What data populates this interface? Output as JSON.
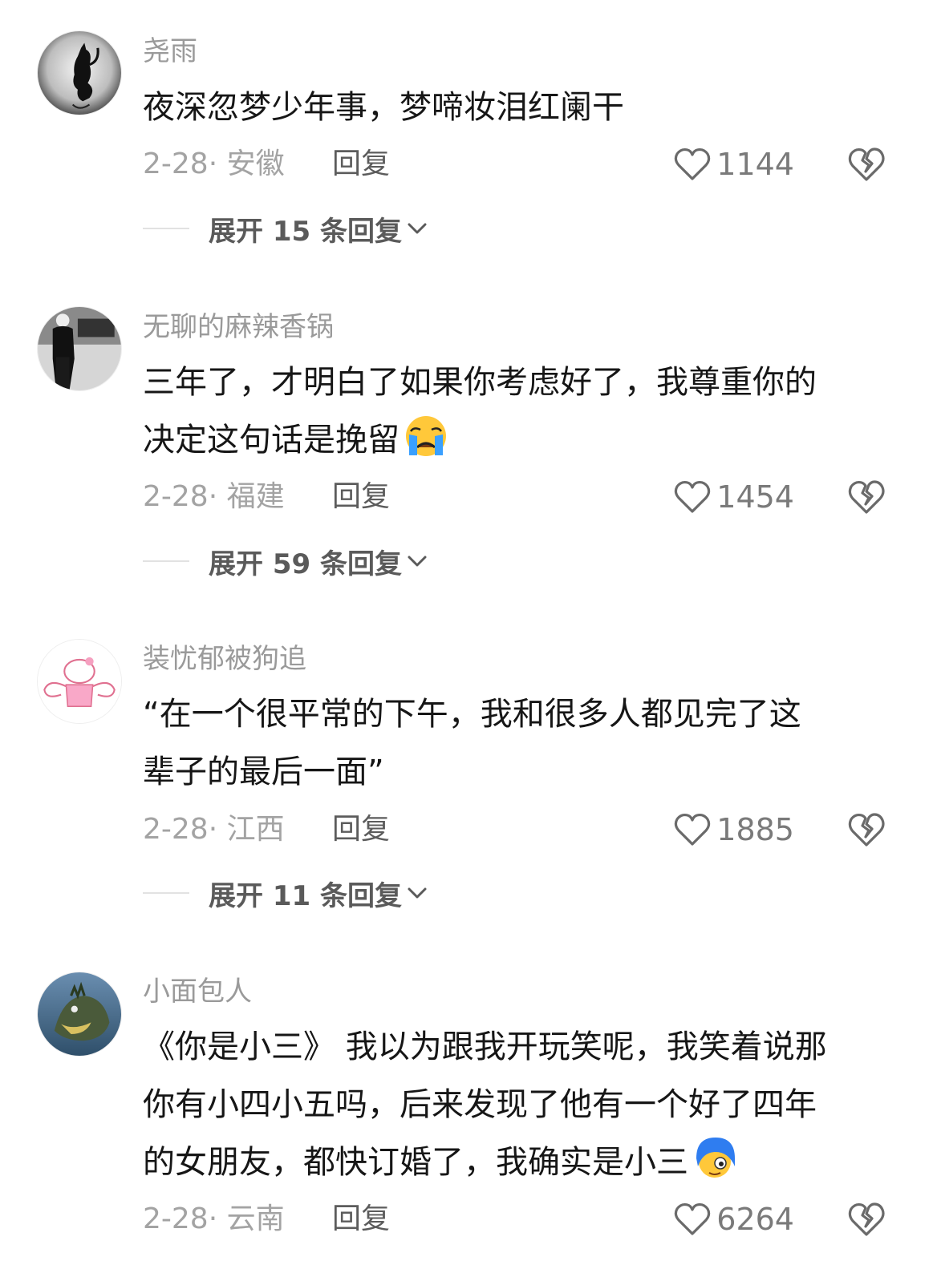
{
  "comments": [
    {
      "username": "尧雨",
      "lines": [
        "夜深忽梦少年事，梦啼妆泪红阑干"
      ],
      "emoji": null,
      "date_location": "2-28· 安徽",
      "reply_label": "回复",
      "likes": "1144",
      "expand_label": "展开 15 条回复"
    },
    {
      "username": "无聊的麻辣香锅",
      "lines": [
        "三年了，才明白了如果你考虑好了，我尊重你的",
        "决定这句话是挽留"
      ],
      "emoji": "crying-face-emoji",
      "date_location": "2-28· 福建",
      "reply_label": "回复",
      "likes": "1454",
      "expand_label": "展开 59 条回复"
    },
    {
      "username": "装忧郁被狗追",
      "lines": [
        "“在一个很平常的下午，我和很多人都见完了这",
        "辈子的最后一面”"
      ],
      "emoji": null,
      "date_location": "2-28· 江西",
      "reply_label": "回复",
      "likes": "1885",
      "expand_label": "展开 11 条回复"
    },
    {
      "username": "小面包人",
      "lines": [
        "《你是小三》 我以为跟我开玩笑呢，我笑着说那",
        "你有小四小五吗，后来发现了他有一个好了四年",
        "的女朋友，都快订婚了，我确实是小三"
      ],
      "emoji": "blue-hair-face-emoji",
      "date_location": "2-28· 云南",
      "reply_label": "回复",
      "likes": "6264",
      "expand_label": null
    }
  ],
  "colors": {
    "username": "#9a9a9a",
    "content": "#161616",
    "meta": "#a3a3a3",
    "icon": "#6a6a6a"
  }
}
